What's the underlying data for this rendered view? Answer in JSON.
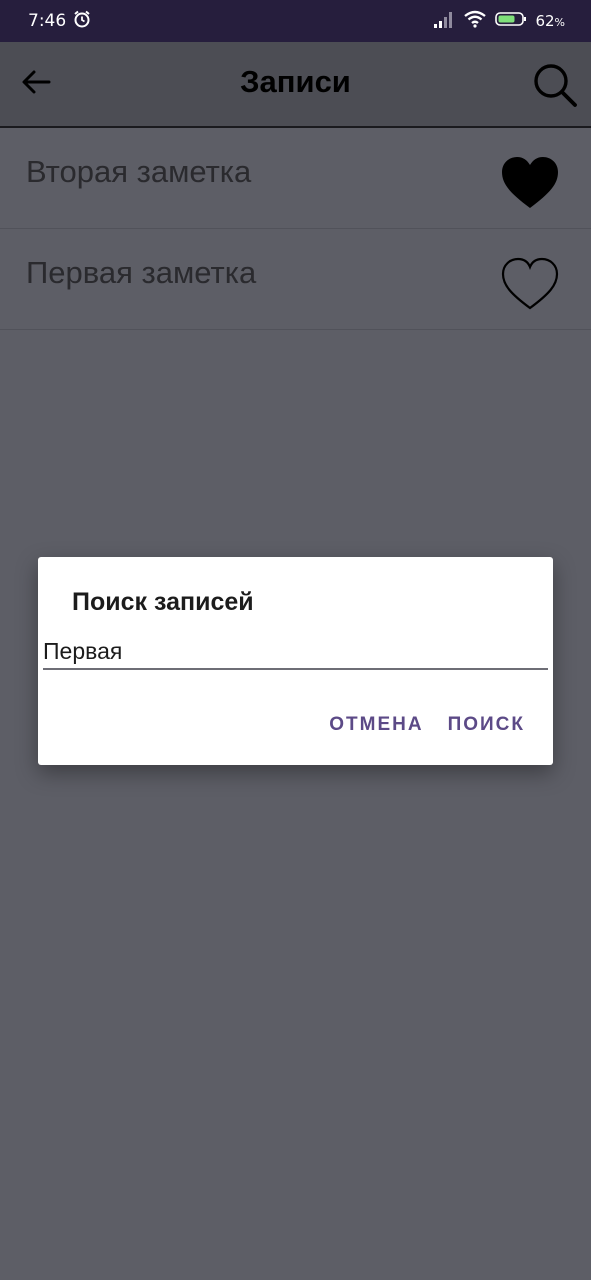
{
  "status_bar": {
    "time": "7:46",
    "battery": "62",
    "battery_unit": "%",
    "icons": [
      "alarm-icon",
      "signal-icon",
      "wifi-icon",
      "battery-icon"
    ]
  },
  "toolbar": {
    "title": "Записи",
    "back_icon": "arrow-left-icon",
    "search_icon": "search-icon"
  },
  "notes": [
    {
      "title": "Вторая заметка",
      "favorite": true,
      "icon": "heart-filled-icon"
    },
    {
      "title": "Первая заметка",
      "favorite": false,
      "icon": "heart-outline-icon"
    }
  ],
  "dialog": {
    "title": "Поиск записей",
    "input_value": "Первая",
    "cancel_label": "ОТМЕНА",
    "search_label": "ПОИСК"
  },
  "colors": {
    "status_bar": "#261e3d",
    "toolbar": "#4c4d54",
    "scrim_background": "#5d5e66",
    "dialog_background": "#ffffff",
    "accent": "#5c4a87"
  }
}
